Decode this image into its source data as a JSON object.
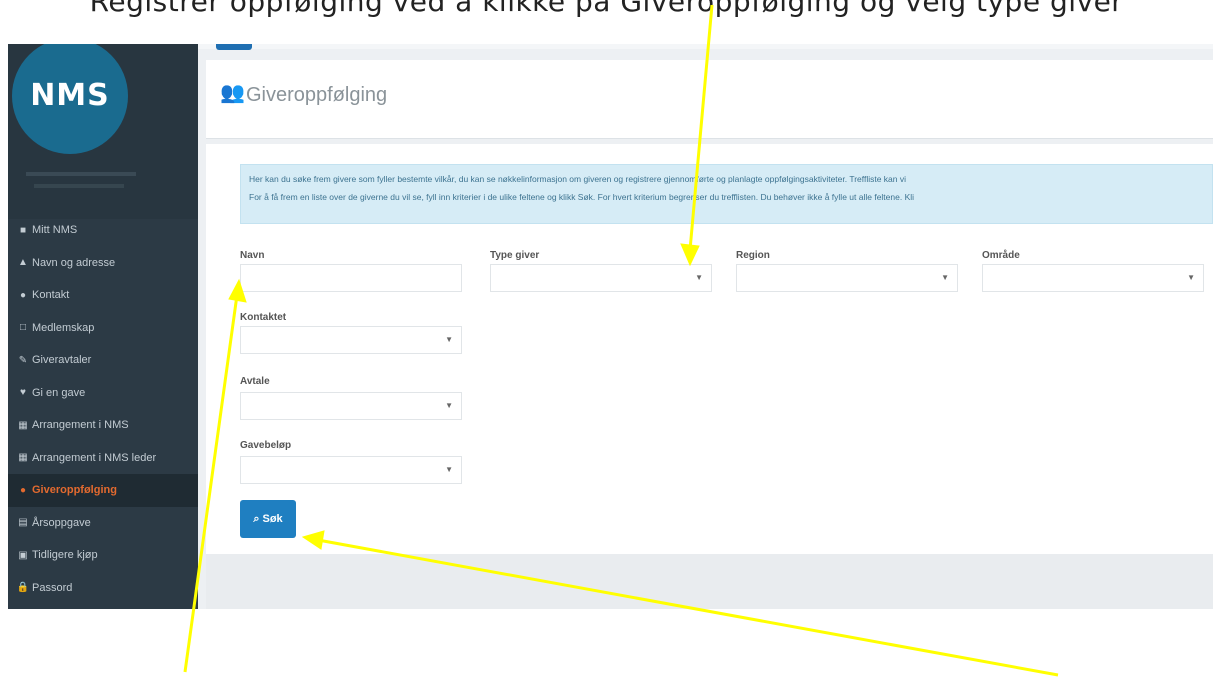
{
  "caption": "Registrer oppfølging ved å klikke på Giveroppfølging og velg type giver",
  "sidebar": {
    "logo_text": "NMS",
    "items": [
      {
        "label": "Mitt NMS",
        "icon": "home-icon"
      },
      {
        "label": "Navn og adresse",
        "icon": "user-icon"
      },
      {
        "label": "Kontakt",
        "icon": "contact-icon"
      },
      {
        "label": "Medlemskap",
        "icon": "membership-icon"
      },
      {
        "label": "Giveravtaler",
        "icon": "pen-icon"
      },
      {
        "label": "Gi en gave",
        "icon": "heart-icon"
      },
      {
        "label": "Arrangement i NMS",
        "icon": "calendar-icon"
      },
      {
        "label": "Arrangement i NMS leder",
        "icon": "calendar-icon"
      },
      {
        "label": "Giveroppfølging",
        "icon": "users-icon",
        "active": true
      },
      {
        "label": "Årsoppgave",
        "icon": "report-icon"
      },
      {
        "label": "Tidligere kjøp",
        "icon": "cart-icon"
      },
      {
        "label": "Passord",
        "icon": "lock-icon"
      }
    ]
  },
  "header": {
    "title": "Giveroppfølging",
    "icon": "users-icon"
  },
  "info": {
    "line1": "Her kan du søke frem givere som fyller bestemte vilkår, du kan se nøkkelinformasjon om giveren og registrere gjennomførte og planlagte oppfølgingsaktiviteter. Treffliste kan vi",
    "line2": "For å få frem en liste over de giverne du vil se, fyll inn kriterier i de ulike feltene og klikk Søk. For hvert kriterium begrenser du trefflisten. Du behøver ikke å fylle ut alle feltene. Kli"
  },
  "form": {
    "navn_label": "Navn",
    "type_giver_label": "Type giver",
    "region_label": "Region",
    "omrade_label": "Område",
    "kontaktet_label": "Kontaktet",
    "avtale_label": "Avtale",
    "gavebelop_label": "Gavebeløp",
    "search_button": "Søk"
  },
  "colors": {
    "annotation_arrow": "#ffff00",
    "sidebar_bg": "#2c3a45",
    "active_item": "#e36a2f",
    "button": "#1f7fc1"
  }
}
